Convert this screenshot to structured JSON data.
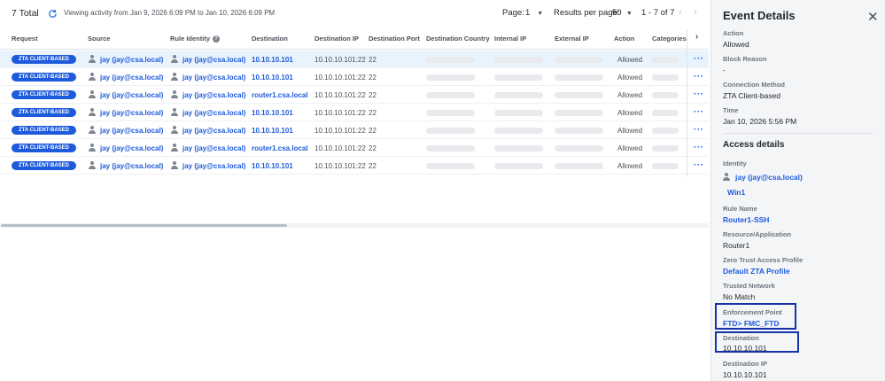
{
  "toolbar": {
    "total": "7 Total",
    "viewing": "Viewing activity from Jan 9, 2026 6:09 PM to Jan 10, 2026 6:09 PM",
    "page_label": "Page:",
    "page_value": "1",
    "rpp_label": "Results per page:",
    "rpp_value": "50",
    "range": "1 - 7 of 7"
  },
  "columns": [
    "Request",
    "Source",
    "Rule Identity",
    "Destination",
    "Destination IP",
    "Destination Port",
    "Destination Country",
    "Internal IP",
    "External IP",
    "Action",
    "Categories"
  ],
  "rows": [
    {
      "request": "ZTA CLIENT-BASED",
      "source": "jay (jay@csa.local)",
      "identity": "jay (jay@csa.local)",
      "destination": "10.10.10.101",
      "dest_ip": "10.10.10.101:22",
      "dest_port": "22",
      "action": "Allowed"
    },
    {
      "request": "ZTA CLIENT-BASED",
      "source": "jay (jay@csa.local)",
      "identity": "jay (jay@csa.local)",
      "destination": "10.10.10.101",
      "dest_ip": "10.10.10.101:22",
      "dest_port": "22",
      "action": "Allowed"
    },
    {
      "request": "ZTA CLIENT-BASED",
      "source": "jay (jay@csa.local)",
      "identity": "jay (jay@csa.local)",
      "destination": "router1.csa.local",
      "dest_ip": "10.10.10.101:22",
      "dest_port": "22",
      "action": "Allowed"
    },
    {
      "request": "ZTA CLIENT-BASED",
      "source": "jay (jay@csa.local)",
      "identity": "jay (jay@csa.local)",
      "destination": "10.10.10.101",
      "dest_ip": "10.10.10.101:22",
      "dest_port": "22",
      "action": "Allowed"
    },
    {
      "request": "ZTA CLIENT-BASED",
      "source": "jay (jay@csa.local)",
      "identity": "jay (jay@csa.local)",
      "destination": "10.10.10.101",
      "dest_ip": "10.10.10.101:22",
      "dest_port": "22",
      "action": "Allowed"
    },
    {
      "request": "ZTA CLIENT-BASED",
      "source": "jay (jay@csa.local)",
      "identity": "jay (jay@csa.local)",
      "destination": "router1.csa.local",
      "dest_ip": "10.10.10.101:22",
      "dest_port": "22",
      "action": "Allowed"
    },
    {
      "request": "ZTA CLIENT-BASED",
      "source": "jay (jay@csa.local)",
      "identity": "jay (jay@csa.local)",
      "destination": "10.10.10.101",
      "dest_ip": "10.10.10.101:22",
      "dest_port": "22",
      "action": "Allowed"
    }
  ],
  "panel": {
    "title": "Event Details",
    "action_label": "Action",
    "action_value": "Allowed",
    "block_label": "Block Reason",
    "block_value": "-",
    "method_label": "Connection Method",
    "method_value": "ZTA Client-based",
    "time_label": "Time",
    "time_value": "Jan 10, 2026 5:56 PM",
    "access_heading": "Access details",
    "identity_label": "Identity",
    "identity_value": "jay (jay@csa.local)",
    "identity_device": "Win1",
    "rule_label": "Rule Name",
    "rule_value": "Router1-SSH",
    "resource_label": "Resource/Application",
    "resource_value": "Router1",
    "ztap_label": "Zero Trust Access Profile",
    "ztap_value": "Default ZTA Profile",
    "trusted_label": "Trusted Network",
    "trusted_value": "No Match",
    "enforce_label": "Enforcement Point",
    "enforce_value": "FTD> FMC_FTD",
    "dest_label": "Destination",
    "dest_value": "10.10.10.101",
    "destip_label": "Destination IP",
    "destip_value": "10.10.10.101"
  }
}
